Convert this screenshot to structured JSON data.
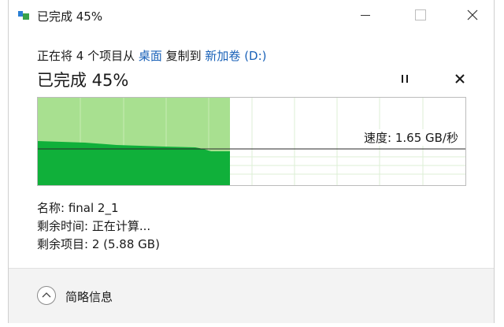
{
  "window": {
    "title": "已完成 45%"
  },
  "copy_line": {
    "prefix": "正在将 4 个项目从 ",
    "source": "桌面",
    "middle": " 复制到 ",
    "destination": "新加卷 (D:)"
  },
  "progress": {
    "heading": "已完成 45%",
    "percent": 45,
    "speed_label": "速度: 1.65 GB/秒"
  },
  "details": {
    "name": "名称: final 2_1",
    "time_remaining": "剩余时间: 正在计算...",
    "items_remaining": "剩余项目: 2 (5.88 GB)"
  },
  "footer": {
    "toggle_label": "简略信息"
  },
  "colors": {
    "progress_light": "#a8e090",
    "progress_dark": "#10b03a",
    "link": "#1a62b8"
  },
  "icons": {
    "app": "file-copy-icon",
    "minimize": "minimize-icon",
    "maximize": "maximize-icon",
    "close": "close-icon",
    "pause": "pause-icon",
    "stop": "stop-icon",
    "chevron": "chevron-up-icon"
  }
}
